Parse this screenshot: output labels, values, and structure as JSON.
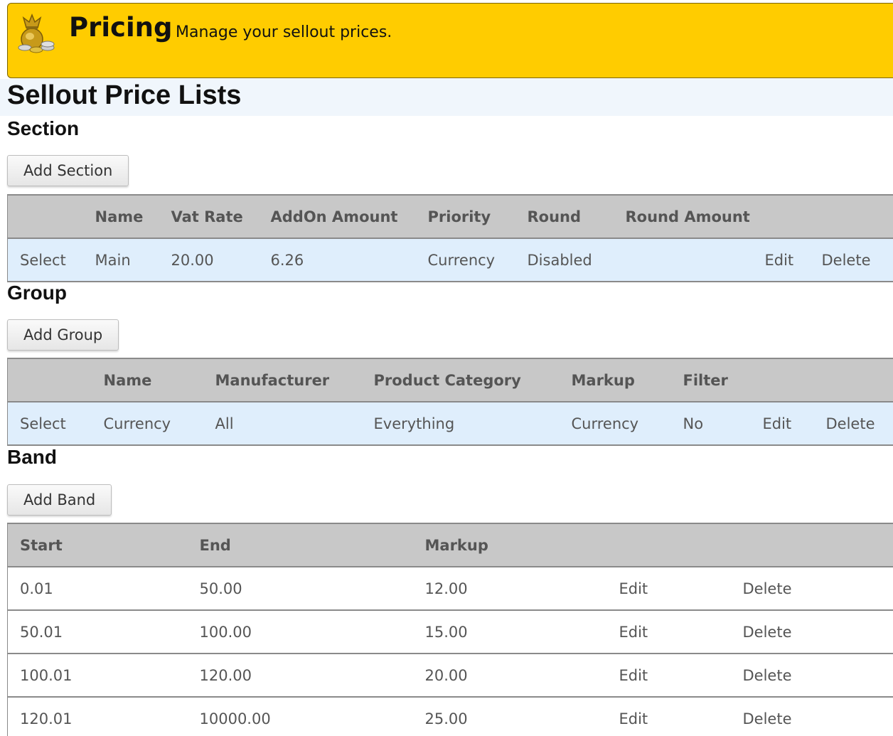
{
  "banner": {
    "title": "Pricing",
    "subtitle": "Manage your sellout prices.",
    "icon": "money-bag-icon",
    "color": "#ffcc00"
  },
  "page_title": "Sellout Price Lists",
  "section": {
    "heading": "Section",
    "add_button": "Add Section",
    "columns": [
      "",
      "Name",
      "Vat Rate",
      "AddOn Amount",
      "Priority",
      "Round",
      "Round Amount",
      "",
      ""
    ],
    "rows": [
      {
        "select": "Select",
        "name": "Main",
        "vat_rate": "20.00",
        "addon_amount": "6.26",
        "priority": "Currency",
        "round": "Disabled",
        "round_amount": "",
        "edit": "Edit",
        "delete": "Delete"
      }
    ]
  },
  "group": {
    "heading": "Group",
    "add_button": "Add Group",
    "columns": [
      "",
      "Name",
      "Manufacturer",
      "Product Category",
      "Markup",
      "Filter",
      "",
      ""
    ],
    "rows": [
      {
        "select": "Select",
        "name": "Currency",
        "manufacturer": "All",
        "product_category": "Everything",
        "markup": "Currency",
        "filter": "No",
        "edit": "Edit",
        "delete": "Delete"
      }
    ]
  },
  "band": {
    "heading": "Band",
    "add_button": "Add Band",
    "columns": [
      "Start",
      "End",
      "Markup",
      "",
      ""
    ],
    "rows": [
      {
        "start": "0.01",
        "end": "50.00",
        "markup": "12.00",
        "edit": "Edit",
        "delete": "Delete"
      },
      {
        "start": "50.01",
        "end": "100.00",
        "markup": "15.00",
        "edit": "Edit",
        "delete": "Delete"
      },
      {
        "start": "100.01",
        "end": "120.00",
        "markup": "20.00",
        "edit": "Edit",
        "delete": "Delete"
      },
      {
        "start": "120.01",
        "end": "10000.00",
        "markup": "25.00",
        "edit": "Edit",
        "delete": "Delete"
      }
    ]
  },
  "colors": {
    "header_bg": "#c8c8c8",
    "selected_row_bg": "#dfeefc",
    "link": "#1a1ae6"
  }
}
